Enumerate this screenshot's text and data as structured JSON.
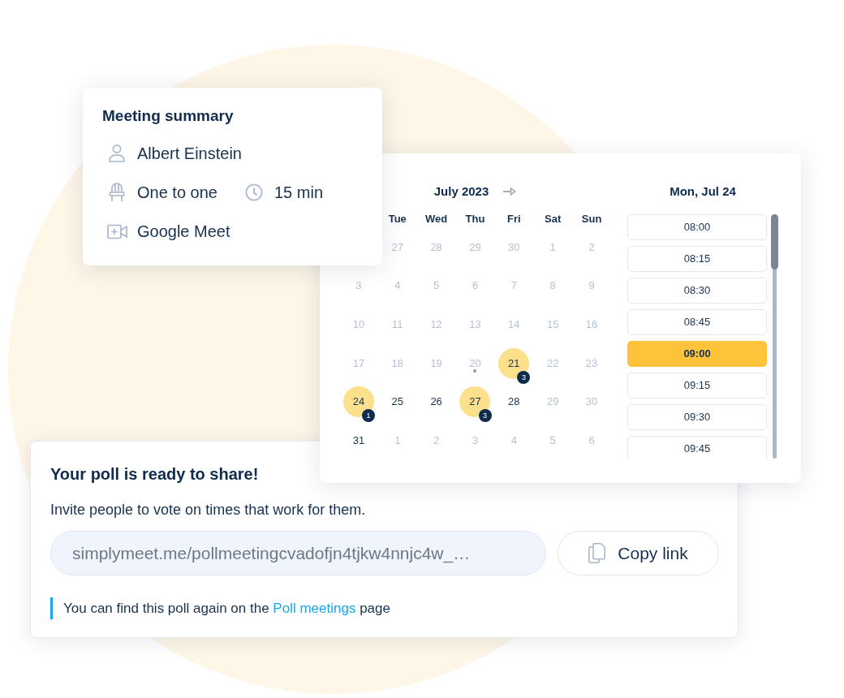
{
  "summary": {
    "title": "Meeting summary",
    "organizer": "Albert Einstein",
    "meeting_type": "One to one",
    "duration": "15 min",
    "location": "Google Meet"
  },
  "calendar": {
    "month": "July 2023",
    "weekdays": [
      "Tue",
      "Wed",
      "Thu",
      "Fri",
      "Sat",
      "Sun"
    ],
    "weeks": [
      {
        "days": [
          {
            "day": "27",
            "muted": true,
            "highlighted": false,
            "today": false
          },
          {
            "day": "28",
            "muted": true,
            "highlighted": false,
            "today": false
          },
          {
            "day": "29",
            "muted": true,
            "highlighted": false,
            "today": false
          },
          {
            "day": "30",
            "muted": true,
            "highlighted": false,
            "today": false
          },
          {
            "day": "1",
            "muted": true,
            "highlighted": false,
            "today": false
          },
          {
            "day": "2",
            "muted": true,
            "highlighted": false,
            "today": false
          }
        ]
      },
      {
        "days": [
          {
            "day": "3",
            "muted": true,
            "highlighted": false,
            "today": false
          },
          {
            "day": "4",
            "muted": true,
            "highlighted": false,
            "today": false
          },
          {
            "day": "5",
            "muted": true,
            "highlighted": false,
            "today": false
          },
          {
            "day": "6",
            "muted": true,
            "highlighted": false,
            "today": false
          },
          {
            "day": "7",
            "muted": true,
            "highlighted": false,
            "today": false
          },
          {
            "day": "8",
            "muted": true,
            "highlighted": false,
            "today": false
          },
          {
            "day": "9",
            "muted": true,
            "highlighted": false,
            "today": false
          }
        ]
      },
      {
        "days": [
          {
            "day": "10",
            "muted": true,
            "highlighted": false,
            "today": false
          },
          {
            "day": "11",
            "muted": true,
            "highlighted": false,
            "today": false
          },
          {
            "day": "12",
            "muted": true,
            "highlighted": false,
            "today": false
          },
          {
            "day": "13",
            "muted": true,
            "highlighted": false,
            "today": false
          },
          {
            "day": "14",
            "muted": true,
            "highlighted": false,
            "today": false
          },
          {
            "day": "15",
            "muted": true,
            "highlighted": false,
            "today": false
          },
          {
            "day": "16",
            "muted": true,
            "highlighted": false,
            "today": false
          }
        ]
      },
      {
        "days": [
          {
            "day": "17",
            "muted": true,
            "highlighted": false,
            "today": false
          },
          {
            "day": "18",
            "muted": true,
            "highlighted": false,
            "today": false
          },
          {
            "day": "19",
            "muted": true,
            "highlighted": false,
            "today": false
          },
          {
            "day": "20",
            "muted": true,
            "highlighted": false,
            "today": true
          },
          {
            "day": "21",
            "muted": false,
            "highlighted": true,
            "today": false,
            "badge": "3"
          },
          {
            "day": "22",
            "muted": true,
            "highlighted": false,
            "today": false
          },
          {
            "day": "23",
            "muted": true,
            "highlighted": false,
            "today": false
          }
        ]
      },
      {
        "days": [
          {
            "day": "24",
            "muted": false,
            "highlighted": true,
            "today": false,
            "badge": "1"
          },
          {
            "day": "25",
            "muted": false,
            "highlighted": false,
            "today": false
          },
          {
            "day": "26",
            "muted": false,
            "highlighted": false,
            "today": false
          },
          {
            "day": "27",
            "muted": false,
            "highlighted": true,
            "today": false,
            "badge": "3"
          },
          {
            "day": "28",
            "muted": false,
            "highlighted": false,
            "today": false
          },
          {
            "day": "29",
            "muted": true,
            "highlighted": false,
            "today": false
          },
          {
            "day": "30",
            "muted": true,
            "highlighted": false,
            "today": false
          }
        ]
      },
      {
        "days": [
          {
            "day": "31",
            "muted": false,
            "highlighted": false,
            "today": false
          },
          {
            "day": "1",
            "muted": true,
            "highlighted": false,
            "today": false
          },
          {
            "day": "2",
            "muted": true,
            "highlighted": false,
            "today": false
          },
          {
            "day": "3",
            "muted": true,
            "highlighted": false,
            "today": false
          },
          {
            "day": "4",
            "muted": true,
            "highlighted": false,
            "today": false
          },
          {
            "day": "5",
            "muted": true,
            "highlighted": false,
            "today": false
          },
          {
            "day": "6",
            "muted": true,
            "highlighted": false,
            "today": false
          }
        ]
      }
    ]
  },
  "time_panel": {
    "date": "Mon, Jul 24",
    "slots": [
      {
        "time": "08:00",
        "selected": false
      },
      {
        "time": "08:15",
        "selected": false
      },
      {
        "time": "08:30",
        "selected": false
      },
      {
        "time": "08:45",
        "selected": false
      },
      {
        "time": "09:00",
        "selected": true
      },
      {
        "time": "09:15",
        "selected": false
      },
      {
        "time": "09:30",
        "selected": false
      },
      {
        "time": "09:45",
        "selected": false
      }
    ]
  },
  "poll": {
    "title": "Your poll is ready to share!",
    "subtitle": "Invite people to vote on times that work for them.",
    "link": "simplymeet.me/pollmeetingcvadofjn4tjkw4nnjc4w_…",
    "copy_button": "Copy link",
    "note": {
      "before": "You can find this poll again on the ",
      "link": "Poll meetings",
      "after": " page"
    }
  }
}
